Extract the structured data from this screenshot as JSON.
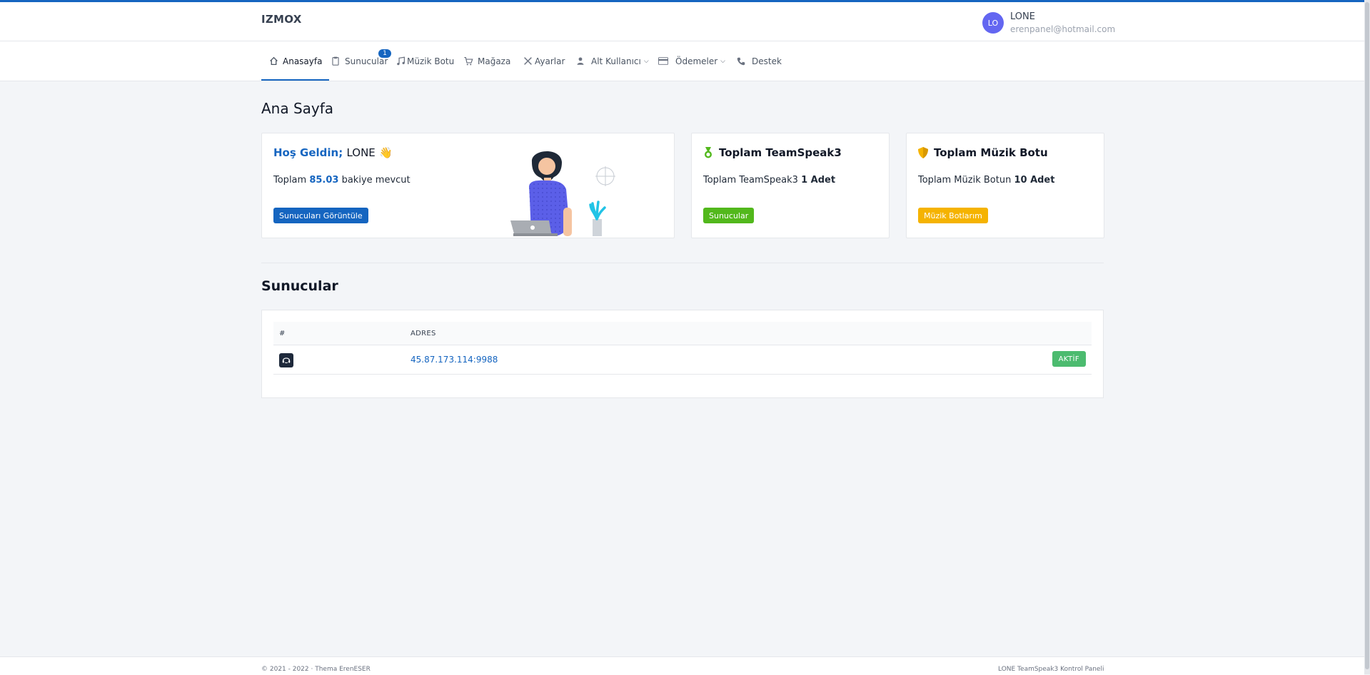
{
  "header": {
    "logo": "IZMOX",
    "user": {
      "initials": "LO",
      "name": "LONE",
      "email": "erenpanel@hotmail.com"
    }
  },
  "nav": {
    "items": [
      {
        "label": "Anasayfa",
        "icon": "home-icon",
        "active": true
      },
      {
        "label": "Sunucular",
        "icon": "clipboard-icon",
        "badge": "1"
      },
      {
        "label": "Müzik Botu",
        "icon": "music-note-icon"
      },
      {
        "label": "Mağaza",
        "icon": "shopping-cart-icon"
      },
      {
        "label": "Ayarlar",
        "icon": "tools-icon"
      },
      {
        "label": "Alt Kullanıcı",
        "icon": "user-icon",
        "dropdown": true
      },
      {
        "label": "Ödemeler",
        "icon": "credit-card-icon",
        "dropdown": true
      },
      {
        "label": "Destek",
        "icon": "phone-icon"
      }
    ]
  },
  "page": {
    "title": "Ana Sayfa"
  },
  "cards": {
    "welcome": {
      "greeting": "Hoş Geldin;",
      "name": "LONE",
      "emoji": "👋",
      "text_pre": "Toplam",
      "balance": "85.03",
      "text_post": "bakiye mevcut",
      "button": "Sunucuları Görüntüle"
    },
    "teamspeak": {
      "title": "Toplam TeamSpeak3",
      "text_pre": "Toplam TeamSpeak3",
      "count": "1 Adet",
      "button": "Sunucular"
    },
    "music": {
      "title": "Toplam Müzik Botu",
      "text_pre": "Toplam Müzik Botun",
      "count": "10 Adet",
      "button": "Müzik Botlarım"
    }
  },
  "servers": {
    "title": "Sunucular",
    "columns": [
      "#",
      "ADRES"
    ],
    "rows": [
      {
        "icon": "teamspeak-icon",
        "address": "45.87.173.114:9988",
        "status": "AKTİF"
      }
    ]
  },
  "footer": {
    "left": "© 2021 - 2022 · Thema ErenESER",
    "right": "LONE TeamSpeak3 Kontrol Paneli"
  },
  "colors": {
    "primary": "#1565c0",
    "success": "#52b81c",
    "warning": "#f5b301",
    "status_green": "#4cbb6f",
    "avatar": "#6366f1"
  }
}
